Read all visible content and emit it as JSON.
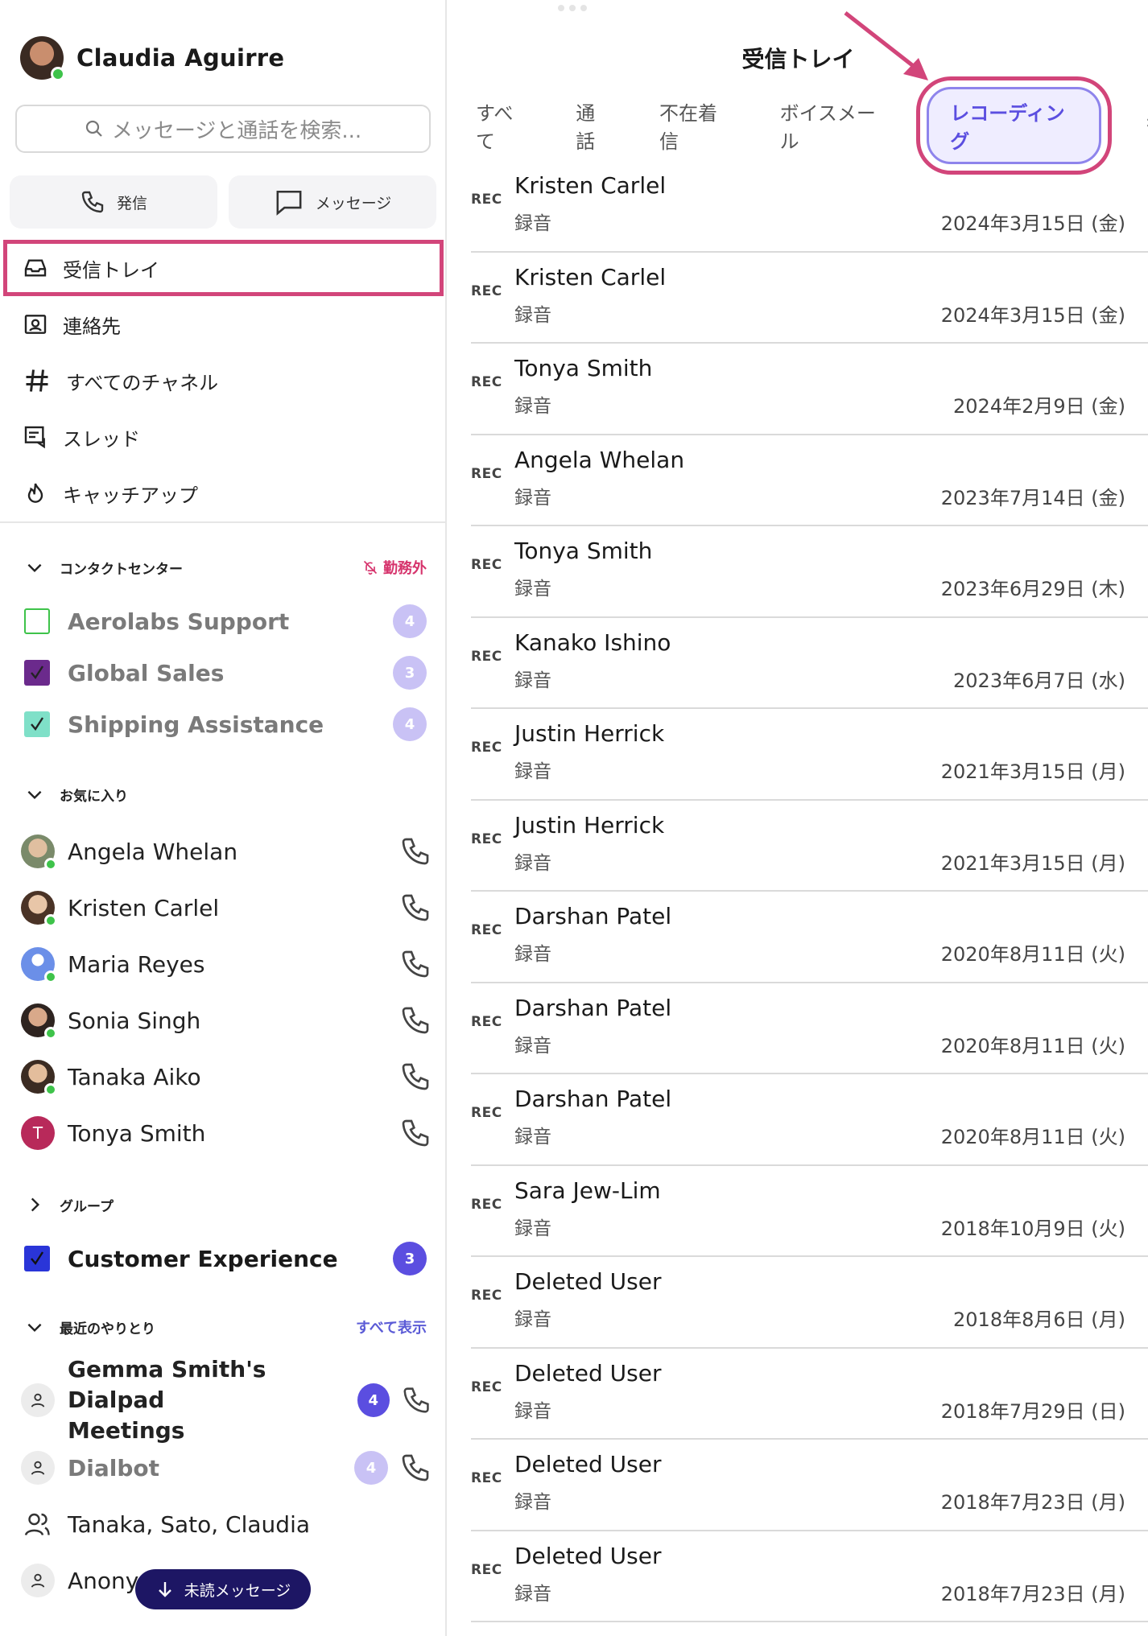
{
  "sidebar": {
    "profile_name": "Claudia  Aguirre",
    "search_placeholder": "メッセージと通話を検索...",
    "actions": {
      "call": "発信",
      "message": "メッセージ"
    },
    "nav": [
      {
        "label": "受信トレイ",
        "icon": "inbox-icon"
      },
      {
        "label": "連絡先",
        "icon": "contacts-icon"
      },
      {
        "label": "すべてのチャネル",
        "icon": "hash-icon"
      },
      {
        "label": "スレッド",
        "icon": "threads-icon"
      },
      {
        "label": "キャッチアップ",
        "icon": "flame-icon"
      }
    ],
    "contact_center": {
      "title": "コンタクトセンター",
      "status": "勤務外",
      "items": [
        {
          "label": "Aerolabs Support",
          "count": "4",
          "color": "#3ec34a"
        },
        {
          "label": "Global Sales",
          "count": "3",
          "color": "#6b2a8c"
        },
        {
          "label": "Shipping Assistance",
          "count": "4",
          "color": "#7fe0c8"
        }
      ]
    },
    "favorites": {
      "title": "お気に入り",
      "items": [
        {
          "label": "Angela Whelan"
        },
        {
          "label": "Kristen Carlel"
        },
        {
          "label": "Maria Reyes"
        },
        {
          "label": "Sonia  Singh"
        },
        {
          "label": "Tanaka Aiko"
        },
        {
          "label": "Tonya Smith",
          "initial": "T"
        }
      ]
    },
    "groups": {
      "title": "グループ",
      "items": [
        {
          "label": "Customer Experience",
          "count": "3"
        }
      ]
    },
    "recent": {
      "title": "最近のやりとり",
      "show_all": "すべて表示",
      "items": [
        {
          "line1": "Gemma Smith's Dialpad",
          "line2": "Meetings",
          "count": "4"
        },
        {
          "label": "Dialbot",
          "count": "4"
        },
        {
          "label": "Tanaka, Sato, Claudia"
        },
        {
          "label": "Anonym"
        }
      ]
    },
    "unread_button": "未読メッセージ"
  },
  "main": {
    "title": "受信トレイ",
    "tabs": [
      "すべて",
      "通話",
      "不在着信",
      "ボイスメール",
      "レコーディング"
    ],
    "active_tab": "レコーディング",
    "rows": [
      {
        "badge": "REC",
        "name": "Kristen Carlel",
        "type": "録音",
        "date": "2024年3月15日 (金)"
      },
      {
        "badge": "REC",
        "name": "Kristen Carlel",
        "type": "録音",
        "date": "2024年3月15日 (金)"
      },
      {
        "badge": "REC",
        "name": "Tonya Smith",
        "type": "録音",
        "date": "2024年2月9日 (金)"
      },
      {
        "badge": "REC",
        "name": "Angela Whelan",
        "type": "録音",
        "date": "2023年7月14日 (金)"
      },
      {
        "badge": "REC",
        "name": "Tonya Smith",
        "type": "録音",
        "date": "2023年6月29日 (木)"
      },
      {
        "badge": "REC",
        "name": "Kanako Ishino",
        "type": "録音",
        "date": "2023年6月7日 (水)"
      },
      {
        "badge": "REC",
        "name": "Justin Herrick",
        "type": "録音",
        "date": "2021年3月15日 (月)"
      },
      {
        "badge": "REC",
        "name": "Justin Herrick",
        "type": "録音",
        "date": "2021年3月15日 (月)"
      },
      {
        "badge": "REC",
        "name": "Darshan Patel",
        "type": "録音",
        "date": "2020年8月11日 (火)"
      },
      {
        "badge": "REC",
        "name": "Darshan Patel",
        "type": "録音",
        "date": "2020年8月11日 (火)"
      },
      {
        "badge": "REC",
        "name": "Darshan Patel",
        "type": "録音",
        "date": "2020年8月11日 (火)"
      },
      {
        "badge": "REC",
        "name": "Sara Jew-Lim",
        "type": "録音",
        "date": "2018年10月9日 (火)"
      },
      {
        "badge": "REC",
        "name": "Deleted User",
        "type": "録音",
        "date": "2018年8月6日 (月)"
      },
      {
        "badge": "REC",
        "name": "Deleted User",
        "type": "録音",
        "date": "2018年7月29日 (日)"
      },
      {
        "badge": "REC",
        "name": "Deleted User",
        "type": "録音",
        "date": "2018年7月23日 (月)"
      },
      {
        "badge": "REC",
        "name": "Deleted User",
        "type": "録音",
        "date": "2018年7月23日 (月)"
      }
    ]
  },
  "colors": {
    "accent": "#5b4ee0",
    "highlight": "#d2457a",
    "online": "#3ec34a"
  }
}
